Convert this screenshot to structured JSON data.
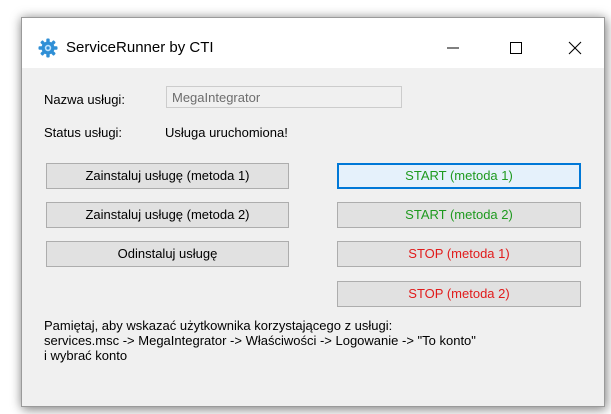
{
  "window": {
    "title": "ServiceRunner by CTI",
    "app_icon": "gear-icon",
    "controls": {
      "minimize": "minimize-icon",
      "maximize": "maximize-icon",
      "close": "close-icon"
    }
  },
  "form": {
    "service_name_label": "Nazwa usługi:",
    "service_name_value": "MegaIntegrator",
    "status_label": "Status usługi:",
    "status_value": "Usługa uruchomiona!"
  },
  "buttons": {
    "install_1": "Zainstaluj usługę (metoda 1)",
    "install_2": "Zainstaluj usługę (metoda 2)",
    "uninstall": "Odinstaluj usługę",
    "start_1": "START (metoda 1)",
    "start_2": "START (metoda 2)",
    "stop_1": "STOP (metoda 1)",
    "stop_2": "STOP (metoda 2)"
  },
  "note": {
    "line1": "Pamiętaj, aby wskazać użytkownika korzystającego z usługi:",
    "line2": "services.msc -> MegaIntegrator -> Właściwości -> Logowanie -> \"To konto\"",
    "line3": "i wybrać konto"
  },
  "colors": {
    "start": "#1f9a1f",
    "stop": "#e11b1b",
    "focus": "#0078d7"
  }
}
